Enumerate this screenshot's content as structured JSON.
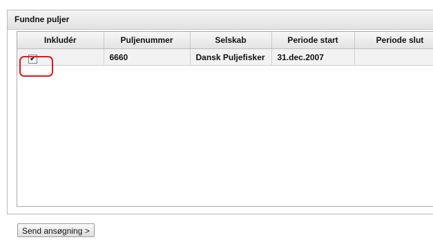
{
  "panel": {
    "title": "Fundne puljer"
  },
  "table": {
    "headers": [
      "Inkludér",
      "Puljenummer",
      "Selskab",
      "Periode start",
      "Periode slut"
    ],
    "rows": [
      {
        "include": "✔",
        "puljenummer": "6660",
        "selskab": "Dansk Puljefisker",
        "periode_start": "31.dec.2007",
        "periode_slut": ""
      }
    ]
  },
  "actions": {
    "send_label": "Send ansøgning >"
  }
}
